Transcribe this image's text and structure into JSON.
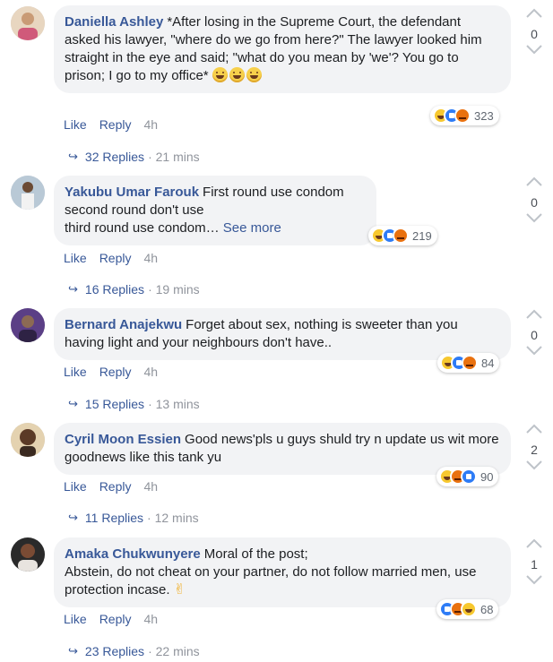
{
  "comments": [
    {
      "author": "Daniella Ashley",
      "text": "*After losing in the Supreme Court, the defendant asked his lawyer, \"where do we go from here?\" The lawyer looked him straight in the eye and said; \"what do you mean by 'we'? You go to prison; I go to my office*",
      "reaction_count": "323",
      "like_label": "Like",
      "reply_label": "Reply",
      "time": "4h",
      "replies_label": "32 Replies",
      "replies_time": "· 21 mins",
      "votes": "0",
      "avatar_color": "#d9b48f"
    },
    {
      "author": "Yakubu Umar Farouk",
      "text_line1": "First round use condom",
      "text_line2": "second round don't use",
      "text_line3": "third round use condom…",
      "see_more": "See more",
      "reaction_count": "219",
      "like_label": "Like",
      "reply_label": "Reply",
      "time": "4h",
      "replies_label": "16 Replies",
      "replies_time": "· 19 mins",
      "votes": "0",
      "avatar_color": "#8fa4b8"
    },
    {
      "author": "Bernard Anajekwu",
      "text": "Forget about sex, nothing is sweeter than you having light and your neighbours don't have..",
      "reaction_count": "84",
      "like_label": "Like",
      "reply_label": "Reply",
      "time": "4h",
      "replies_label": "15 Replies",
      "replies_time": "· 13 mins",
      "votes": "0",
      "avatar_color": "#6a4c8a"
    },
    {
      "author": "Cyril Moon Essien",
      "text": "Good news'pls u guys shuld try n update us wit more goodnews like this tank yu",
      "reaction_count": "90",
      "like_label": "Like",
      "reply_label": "Reply",
      "time": "4h",
      "replies_label": "11 Replies",
      "replies_time": "· 12 mins",
      "votes": "2",
      "avatar_color": "#5b3a26"
    },
    {
      "author": "Amaka Chukwunyere",
      "text_line1": "Moral of the post;",
      "text_line2": "Abstein, do not cheat on your partner, do not follow married men, use protection incase.",
      "reaction_count": "68",
      "like_label": "Like",
      "reply_label": "Reply",
      "time": "4h",
      "replies_label": "23 Replies",
      "replies_time": "· 22 mins",
      "votes": "1",
      "avatar_color": "#3b2a2a"
    }
  ]
}
